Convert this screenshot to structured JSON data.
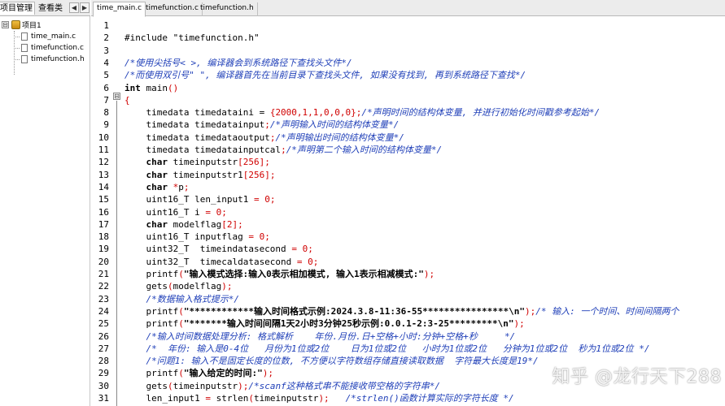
{
  "left_panel": {
    "tabs": [
      "项目管理",
      "查看类"
    ],
    "nav_left": "◀",
    "nav_right": "▶",
    "tree": {
      "root": "项目1",
      "expander": "⊟",
      "files": [
        "time_main.c",
        "timefunction.c",
        "timefunction.h"
      ]
    }
  },
  "editor_tabs": [
    "time_main.c",
    "timefunction.c",
    "timefunction.h"
  ],
  "fold_symbol": "⊟",
  "code_lines": [
    {
      "n": "1",
      "segs": []
    },
    {
      "n": "2",
      "segs": [
        {
          "c": "pp",
          "t": "#include \"timefunction.h\""
        }
      ]
    },
    {
      "n": "3",
      "segs": []
    },
    {
      "n": "4",
      "segs": [
        {
          "c": "cm",
          "t": "/*使用尖括号< >, 编译器会到系统路径下查找头文件*/"
        }
      ]
    },
    {
      "n": "5",
      "segs": [
        {
          "c": "cm",
          "t": "/*而使用双引号\" \", 编译器首先在当前目录下查找头文件, 如果没有找到, 再到系统路径下查找*/"
        }
      ]
    },
    {
      "n": "6",
      "segs": [
        {
          "c": "kw",
          "t": "int"
        },
        {
          "c": "op",
          "t": " main"
        },
        {
          "c": "punc",
          "t": "()"
        }
      ]
    },
    {
      "n": "7",
      "segs": [
        {
          "c": "punc",
          "t": "{"
        }
      ]
    },
    {
      "n": "8",
      "segs": [
        {
          "c": "op",
          "t": "    timedata timedataini = "
        },
        {
          "c": "punc",
          "t": "{"
        },
        {
          "c": "num",
          "t": "2000,1,1,0,0,0"
        },
        {
          "c": "punc",
          "t": "};"
        },
        {
          "c": "cm",
          "t": "/*声明时间的结构体变量, 并进行初始化时间戳参考起始*/"
        }
      ]
    },
    {
      "n": "9",
      "segs": [
        {
          "c": "op",
          "t": "    timedata timedatainput"
        },
        {
          "c": "punc",
          "t": ";"
        },
        {
          "c": "cm",
          "t": "/*声明输入时间的结构体变量*/"
        }
      ]
    },
    {
      "n": "10",
      "segs": [
        {
          "c": "op",
          "t": "    timedata timedataoutput"
        },
        {
          "c": "punc",
          "t": ";"
        },
        {
          "c": "cm",
          "t": "/*声明输出时间的结构体变量*/"
        }
      ]
    },
    {
      "n": "11",
      "segs": [
        {
          "c": "op",
          "t": "    timedata timedatainputcal"
        },
        {
          "c": "punc",
          "t": ";"
        },
        {
          "c": "cm",
          "t": "/*声明第二个输入时间的结构体变量*/"
        }
      ]
    },
    {
      "n": "12",
      "segs": [
        {
          "c": "kw",
          "t": "    char"
        },
        {
          "c": "op",
          "t": " timeinputstr"
        },
        {
          "c": "punc",
          "t": "["
        },
        {
          "c": "num",
          "t": "256"
        },
        {
          "c": "punc",
          "t": "];"
        }
      ]
    },
    {
      "n": "13",
      "segs": [
        {
          "c": "kw",
          "t": "    char"
        },
        {
          "c": "op",
          "t": " timeinputstr1"
        },
        {
          "c": "punc",
          "t": "["
        },
        {
          "c": "num",
          "t": "256"
        },
        {
          "c": "punc",
          "t": "];"
        }
      ]
    },
    {
      "n": "14",
      "segs": [
        {
          "c": "kw",
          "t": "    char"
        },
        {
          "c": "op",
          "t": " "
        },
        {
          "c": "punc",
          "t": "*"
        },
        {
          "c": "op",
          "t": "p"
        },
        {
          "c": "punc",
          "t": ";"
        }
      ]
    },
    {
      "n": "15",
      "segs": [
        {
          "c": "op",
          "t": "    uint16_T len_input1 "
        },
        {
          "c": "punc",
          "t": "="
        },
        {
          "c": "op",
          "t": " "
        },
        {
          "c": "num",
          "t": "0"
        },
        {
          "c": "punc",
          "t": ";"
        }
      ]
    },
    {
      "n": "16",
      "segs": [
        {
          "c": "op",
          "t": "    uint16_T i "
        },
        {
          "c": "punc",
          "t": "="
        },
        {
          "c": "op",
          "t": " "
        },
        {
          "c": "num",
          "t": "0"
        },
        {
          "c": "punc",
          "t": ";"
        }
      ]
    },
    {
      "n": "17",
      "segs": [
        {
          "c": "kw",
          "t": "    char"
        },
        {
          "c": "op",
          "t": " modelflag"
        },
        {
          "c": "punc",
          "t": "["
        },
        {
          "c": "num",
          "t": "2"
        },
        {
          "c": "punc",
          "t": "];"
        }
      ]
    },
    {
      "n": "18",
      "segs": [
        {
          "c": "op",
          "t": "    uint16_T inputflag "
        },
        {
          "c": "punc",
          "t": "="
        },
        {
          "c": "op",
          "t": " "
        },
        {
          "c": "num",
          "t": "0"
        },
        {
          "c": "punc",
          "t": ";"
        }
      ]
    },
    {
      "n": "19",
      "segs": [
        {
          "c": "op",
          "t": "    uint32_T  timeindatasecond "
        },
        {
          "c": "punc",
          "t": "="
        },
        {
          "c": "op",
          "t": " "
        },
        {
          "c": "num",
          "t": "0"
        },
        {
          "c": "punc",
          "t": ";"
        }
      ]
    },
    {
      "n": "20",
      "segs": [
        {
          "c": "op",
          "t": "    uint32_T  timecaldatasecond "
        },
        {
          "c": "punc",
          "t": "="
        },
        {
          "c": "op",
          "t": " "
        },
        {
          "c": "num",
          "t": "0"
        },
        {
          "c": "punc",
          "t": ";"
        }
      ]
    },
    {
      "n": "21",
      "segs": [
        {
          "c": "op",
          "t": "    printf"
        },
        {
          "c": "punc",
          "t": "("
        },
        {
          "c": "str",
          "t": "\"输入模式选择:输入0表示相加模式, 输入1表示相减模式:\""
        },
        {
          "c": "punc",
          "t": ");"
        }
      ]
    },
    {
      "n": "22",
      "segs": [
        {
          "c": "op",
          "t": "    gets"
        },
        {
          "c": "punc",
          "t": "("
        },
        {
          "c": "op",
          "t": "modelflag"
        },
        {
          "c": "punc",
          "t": ");"
        }
      ]
    },
    {
      "n": "23",
      "segs": [
        {
          "c": "cm",
          "t": "    /*数据输入格式提示*/"
        }
      ]
    },
    {
      "n": "24",
      "segs": [
        {
          "c": "op",
          "t": "    printf"
        },
        {
          "c": "punc",
          "t": "("
        },
        {
          "c": "str",
          "t": "\"************输入时间格式示例:2024.3.8-11:36-55****************\\n\""
        },
        {
          "c": "punc",
          "t": ");"
        },
        {
          "c": "cm",
          "t": "/* 输入: 一个时间、时间间隔两个"
        }
      ]
    },
    {
      "n": "25",
      "segs": [
        {
          "c": "op",
          "t": "    printf"
        },
        {
          "c": "punc",
          "t": "("
        },
        {
          "c": "str",
          "t": "\"*******输入时间间隔1天2小时3分钟25秒示例:0.0.1-2:3-25*********\\n\""
        },
        {
          "c": "punc",
          "t": ");"
        }
      ]
    },
    {
      "n": "26",
      "segs": [
        {
          "c": "cm",
          "t": "    /*输入时间数据处理分析: 格式解析    年份.月份.日+空格+小时:分钟+空格+秒     */"
        }
      ]
    },
    {
      "n": "27",
      "segs": [
        {
          "c": "cm",
          "t": "    /*  年份: 输入是0-4位   月份为1位或2位    日为1位或2位   小时为1位或2位   分钟为1位或2位  秒为1位或2位 */"
        }
      ]
    },
    {
      "n": "28",
      "segs": [
        {
          "c": "cm",
          "t": "    /*问题1: 输入不是固定长度的位数, 不方便以字符数组存储直接读取数据  字符最大长度是19*/"
        }
      ]
    },
    {
      "n": "29",
      "segs": [
        {
          "c": "op",
          "t": "    printf"
        },
        {
          "c": "punc",
          "t": "("
        },
        {
          "c": "str",
          "t": "\"输入给定的时间:\""
        },
        {
          "c": "punc",
          "t": ");"
        }
      ]
    },
    {
      "n": "30",
      "segs": [
        {
          "c": "op",
          "t": "    gets"
        },
        {
          "c": "punc",
          "t": "("
        },
        {
          "c": "op",
          "t": "timeinputstr"
        },
        {
          "c": "punc",
          "t": ");"
        },
        {
          "c": "cm",
          "t": "/*scanf这种格式串不能接收带空格的字符串*/"
        }
      ]
    },
    {
      "n": "31",
      "segs": [
        {
          "c": "op",
          "t": "    len_input1 "
        },
        {
          "c": "punc",
          "t": "="
        },
        {
          "c": "op",
          "t": " strlen"
        },
        {
          "c": "punc",
          "t": "("
        },
        {
          "c": "op",
          "t": "timeinputstr"
        },
        {
          "c": "punc",
          "t": ");"
        },
        {
          "c": "op",
          "t": "   "
        },
        {
          "c": "cm",
          "t": "/*strlen()函数计算实际的字符长度 */"
        }
      ]
    }
  ],
  "watermark": "知乎 @龙行天下288"
}
